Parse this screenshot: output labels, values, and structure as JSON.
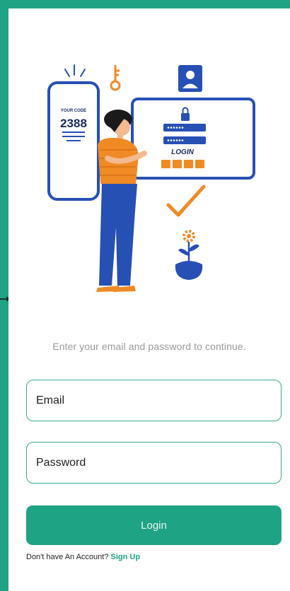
{
  "illustration": {
    "phone_caption": "YOUR CODE",
    "phone_code": "2388",
    "monitor_login_label": "LOGIN"
  },
  "form": {
    "subtitle": "Enter your email and password to continue.",
    "email_placeholder": "Email",
    "password_placeholder": "Password",
    "login_label": "Login",
    "signup_prompt": "Don't have An Account?",
    "signup_link": "Sign Up"
  },
  "colors": {
    "accent": "#1fa385",
    "figure_blue": "#2750b4",
    "figure_orange": "#f08a24"
  }
}
